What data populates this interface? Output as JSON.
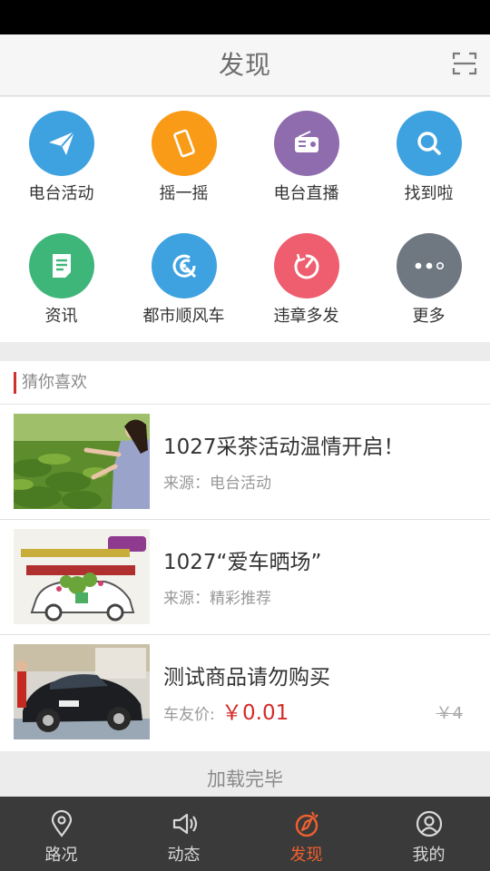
{
  "header": {
    "title": "发现"
  },
  "grid": [
    {
      "label": "电台活动",
      "color": "#3fa2e0",
      "icon": "paper-plane-icon"
    },
    {
      "label": "摇一摇",
      "color": "#f99b16",
      "icon": "phone-shake-icon"
    },
    {
      "label": "电台直播",
      "color": "#8f6cae",
      "icon": "radio-icon"
    },
    {
      "label": "找到啦",
      "color": "#3fa2e0",
      "icon": "search-icon"
    },
    {
      "label": "资讯",
      "color": "#3fb679",
      "icon": "document-icon"
    },
    {
      "label": "都市顺风车",
      "color": "#3fa2e0",
      "icon": "steering-wheel-icon"
    },
    {
      "label": "违章多发",
      "color": "#ee5e6f",
      "icon": "gauge-icon"
    },
    {
      "label": "更多",
      "color": "#6f7781",
      "icon": "more-dots-icon"
    }
  ],
  "recommend": {
    "title": "猜你喜欢",
    "items": [
      {
        "title": "1027采茶活动温情开启！",
        "source": "来源：电台活动"
      },
      {
        "title": "1027“爱车晒场”",
        "source": "来源：精彩推荐"
      },
      {
        "title": "测试商品请勿购买",
        "price_label": "车友价:",
        "price": "￥0.01",
        "original_price": "￥4"
      }
    ]
  },
  "footer_status": "加载完毕",
  "tabs": [
    {
      "label": "路况",
      "icon": "location-pin-icon",
      "active": false
    },
    {
      "label": "动态",
      "icon": "speaker-icon",
      "active": false
    },
    {
      "label": "发现",
      "icon": "discover-icon",
      "active": true
    },
    {
      "label": "我的",
      "icon": "user-icon",
      "active": false
    }
  ],
  "accent_color": "#f0602f"
}
